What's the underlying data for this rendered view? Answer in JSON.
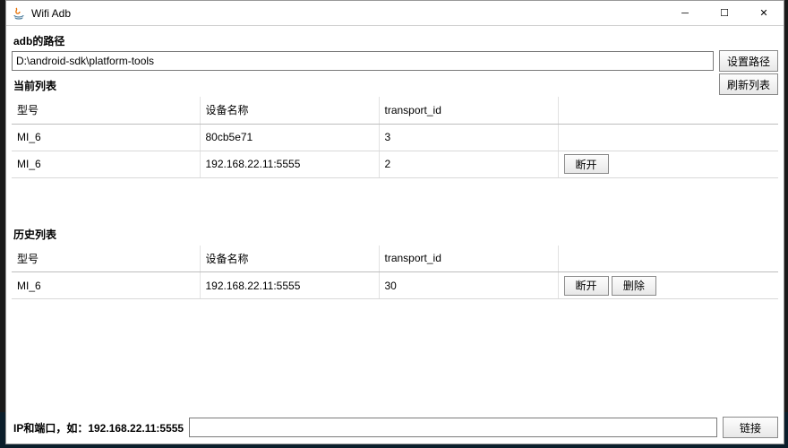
{
  "window": {
    "title": "Wifi Adb"
  },
  "path": {
    "label": "adb的路径",
    "value": "D:\\android-sdk\\platform-tools",
    "set_button": "设置路径"
  },
  "refresh_button": "刷新列表",
  "current": {
    "label": "当前列表",
    "cols": {
      "model": "型号",
      "name": "设备名称",
      "transport_id": "transport_id"
    },
    "rows": [
      {
        "model": "MI_6",
        "name": "80cb5e71",
        "transport_id": "3",
        "action": ""
      },
      {
        "model": "MI_6",
        "name": "192.168.22.11:5555",
        "transport_id": "2",
        "action": "断开"
      }
    ]
  },
  "history": {
    "label": "历史列表",
    "cols": {
      "model": "型号",
      "name": "设备名称",
      "transport_id": "transport_id"
    },
    "rows": [
      {
        "model": "MI_6",
        "name": "192.168.22.11:5555",
        "transport_id": "30",
        "action1": "断开",
        "action2": "删除"
      }
    ]
  },
  "connect": {
    "label": "IP和端口，如：192.168.22.11:5555",
    "value": "",
    "button": "链接"
  }
}
